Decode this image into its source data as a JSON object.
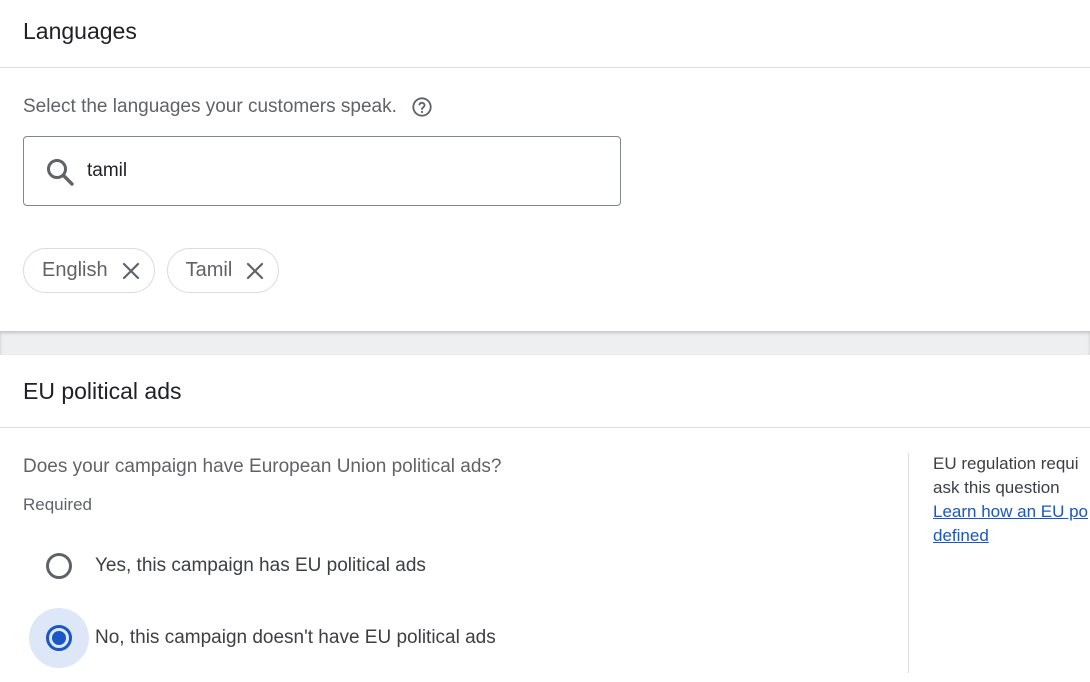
{
  "languages": {
    "title": "Languages",
    "prompt": "Select the languages your customers speak.",
    "search": {
      "value": "tamil"
    },
    "chips": [
      {
        "label": "English"
      },
      {
        "label": "Tamil"
      }
    ]
  },
  "eu_political_ads": {
    "title": "EU political ads",
    "question": "Does your campaign have European Union political ads?",
    "required_label": "Required",
    "options": [
      {
        "label": "Yes, this campaign has EU political ads",
        "selected": false
      },
      {
        "label": "No, this campaign doesn't have EU political ads",
        "selected": true
      }
    ],
    "side_panel": {
      "text_line1": "EU regulation requi",
      "text_line2": "ask this question",
      "link_line1": "Learn how an EU po",
      "link_line2": "defined"
    }
  },
  "colors": {
    "accent": "#1a56c4",
    "selected_halo": "#dde7f7",
    "border": "#dadce0",
    "text_secondary": "#5f6368"
  },
  "icons": {
    "help": "help-circle-icon",
    "search": "search-icon",
    "chip_remove": "close-icon"
  }
}
